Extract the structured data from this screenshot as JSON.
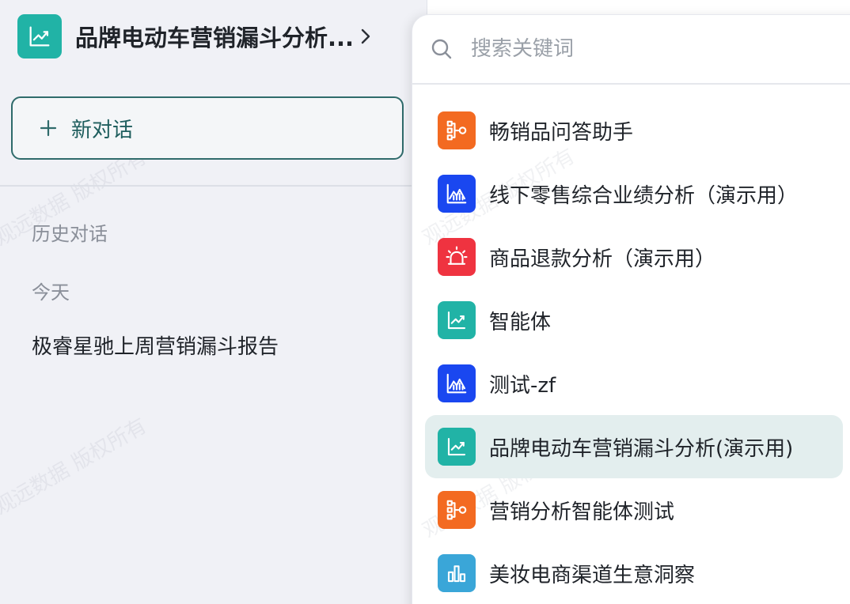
{
  "sidebar": {
    "title": "品牌电动车营销漏斗分析...",
    "icon_color": "#21b3a6",
    "new_chat_label": "新对话",
    "history_label": "历史对话",
    "today_label": "今天",
    "history_items": [
      "极睿星驰上周营销漏斗报告"
    ],
    "watermark": "观远数据 版权所有"
  },
  "search": {
    "placeholder": "搜索关键词",
    "value": ""
  },
  "agents": [
    {
      "label": "畅销品问答助手",
      "icon": "flow-icon",
      "color": "#f36a21"
    },
    {
      "label": "线下零售综合业绩分析（演示用）",
      "icon": "area-chart-icon",
      "color": "#1a47f0"
    },
    {
      "label": "商品退款分析（演示用）",
      "icon": "alarm-icon",
      "color": "#ef3340"
    },
    {
      "label": "智能体",
      "icon": "line-chart-icon",
      "color": "#21b3a6"
    },
    {
      "label": "测试-zf",
      "icon": "area-chart-icon",
      "color": "#1a47f0"
    },
    {
      "label": "品牌电动车营销漏斗分析(演示用)",
      "icon": "line-chart-icon",
      "color": "#21b3a6",
      "selected": true
    },
    {
      "label": "营销分析智能体测试",
      "icon": "flow-icon",
      "color": "#f36a21"
    },
    {
      "label": "美妆电商渠道生意洞察",
      "icon": "bar-chart-icon",
      "color": "#3aa6d8"
    }
  ]
}
